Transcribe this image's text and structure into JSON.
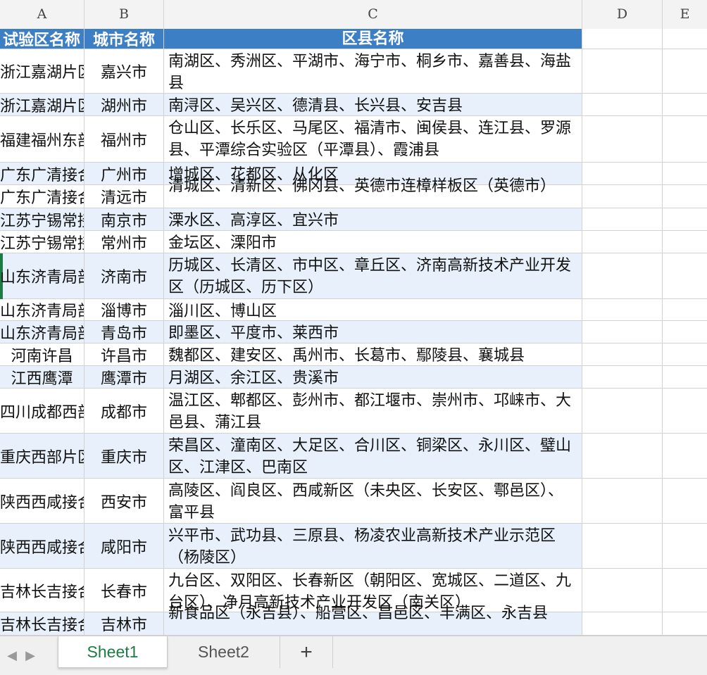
{
  "columns": [
    "A",
    "B",
    "C",
    "D",
    "E"
  ],
  "header": {
    "a": "试验区名称",
    "b": "城市名称",
    "c": "区县名称"
  },
  "rows": [
    {
      "a": "浙江嘉湖片区",
      "b": "嘉兴市",
      "c": "南湖区、秀洲区、平湖市、海宁市、桐乡市、嘉善县、海盐县"
    },
    {
      "a": "浙江嘉湖片区",
      "b": "湖州市",
      "c": "南浔区、吴兴区、德清县、长兴县、安吉县"
    },
    {
      "a": "福建福州东部片区",
      "b": "福州市",
      "c": "仓山区、长乐区、马尾区、福清市、闽侯县、连江县、罗源县、平潭综合实验区（平潭县）、霞浦县"
    },
    {
      "a": "广东广清接合片区",
      "b": "广州市",
      "c": "增城区、花都区、从化区"
    },
    {
      "a": "广东广清接合片区",
      "b": "清远市",
      "c": "清城区、清新区、佛冈县、英德市连樟样板区（英德市）"
    },
    {
      "a": "江苏宁锡常接合片区",
      "b": "南京市",
      "c": "溧水区、高淳区、宜兴市"
    },
    {
      "a": "江苏宁锡常接合片区",
      "b": "常州市",
      "c": "金坛区、溧阳市"
    },
    {
      "a": "山东济青局部片区",
      "b": "济南市",
      "c": "历城区、长清区、市中区、章丘区、济南高新技术产业开发区（历城区、历下区）"
    },
    {
      "a": "山东济青局部片区",
      "b": "淄博市",
      "c": "淄川区、博山区"
    },
    {
      "a": "山东济青局部片区",
      "b": "青岛市",
      "c": "即墨区、平度市、莱西市"
    },
    {
      "a": "河南许昌",
      "b": "许昌市",
      "c": "魏都区、建安区、禹州市、长葛市、鄢陵县、襄城县"
    },
    {
      "a": "江西鹰潭",
      "b": "鹰潭市",
      "c": "月湖区、余江区、贵溪市"
    },
    {
      "a": "四川成都西部片区",
      "b": "成都市",
      "c": "温江区、郫都区、彭州市、都江堰市、崇州市、邛崃市、大邑县、蒲江县"
    },
    {
      "a": "重庆西部片区",
      "b": "重庆市",
      "c": "荣昌区、潼南区、大足区、合川区、铜梁区、永川区、璧山区、江津区、巴南区"
    },
    {
      "a": "陕西西咸接合片区",
      "b": "西安市",
      "c": "高陵区、阎良区、西咸新区（未央区、长安区、鄠邑区）、富平县"
    },
    {
      "a": "陕西西咸接合片区",
      "b": "咸阳市",
      "c": "兴平市、武功县、三原县、杨凌农业高新技术产业示范区（杨陵区）"
    },
    {
      "a": "吉林长吉接合片区",
      "b": "长春市",
      "c": "九台区、双阳区、长春新区（朝阳区、宽城区、二道区、九台区）、净月高新技术产业开发区（南关区）"
    },
    {
      "a": "吉林长吉接合片区",
      "b": "吉林市",
      "c": "船营区、昌邑区、丰满区、永吉县（永吉县）"
    }
  ],
  "row18_visible_fragment": "新食品区（永吉县）、船营区、昌邑区、丰满区、永吉县",
  "tabs": {
    "nav_prev": "◀",
    "nav_next": "▶",
    "sheet1": "Sheet1",
    "sheet2": "Sheet2",
    "add": "+"
  },
  "colors": {
    "header_fill": "#3d7fc4",
    "band_fill": "#e8f1fb",
    "active_tab": "#1e7b45"
  }
}
